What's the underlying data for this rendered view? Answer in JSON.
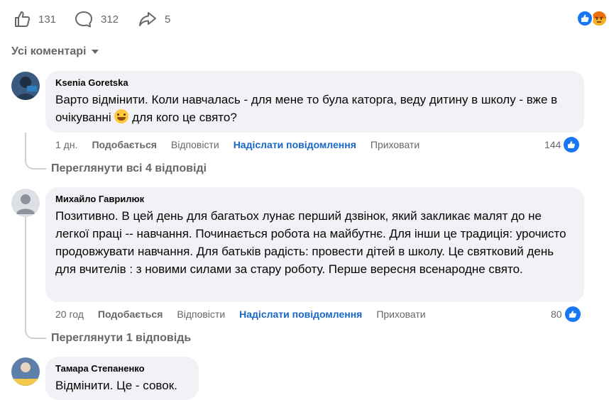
{
  "stats": {
    "likes": "131",
    "comments": "312",
    "shares": "5",
    "like_icon": "thumbs-up-icon",
    "comment_icon": "comment-bubble-icon",
    "share_icon": "share-arrow-icon"
  },
  "reactions": [
    "like-reaction-icon",
    "angry-reaction-icon"
  ],
  "filter": {
    "label": "Усі коментарі"
  },
  "actions": {
    "like": "Подобається",
    "reply": "Відповісти",
    "send_message": "Надіслати повідомлення",
    "hide": "Приховати"
  },
  "comments": [
    {
      "author": "Ksenia Goretska",
      "text_before_emoji": "Варто відмінити. Коли навчалась - для мене то була каторга, веду дитину в школу - вже в очікуванні",
      "emoji": "grinning-sweat-emoji",
      "text_after_emoji": " для кого це свято?",
      "time": "1 дн.",
      "likes": "144",
      "replies_label": "Переглянути всі 4 відповіді"
    },
    {
      "author": "Михайло Гаврилюк",
      "text": "Позитивно. В цей день для багатьох лунає перший дзвінок, який закликає малят до не легкої праці -- навчання. Починається робота на майбутнє. Для інши це традиція: урочисто продовжувати навчання. Для батьків радість: провести дітей в школу. Це святковий день для вчителів : з новими силами за стару роботу. Перше вересня всенародне свято.",
      "time": "20 год",
      "likes": "80",
      "replies_label": "Переглянути 1 відповідь"
    },
    {
      "author": "Тамара Степаненко",
      "text": "Відмінити. Це - совок."
    }
  ],
  "colors": {
    "accent_blue": "#1877f2",
    "link_blue": "#1866c7",
    "bubble_bg": "#f0f2f5",
    "muted_text": "#65676b"
  }
}
